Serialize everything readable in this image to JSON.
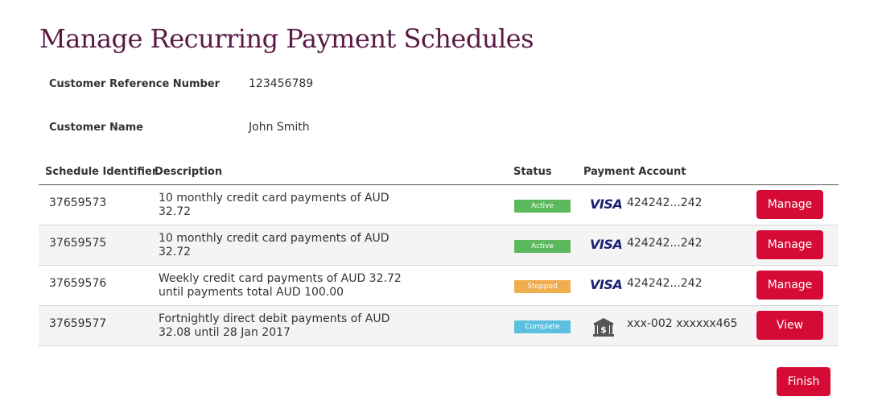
{
  "page": {
    "title": "Manage Recurring Payment Schedules"
  },
  "customer": {
    "reference_label": "Customer Reference Number",
    "reference_value": "123456789",
    "name_label": "Customer Name",
    "name_value": "John Smith"
  },
  "table": {
    "headers": {
      "schedule_id": "Schedule Identifier",
      "description": "Description",
      "status": "Status",
      "payment_account": "Payment Account"
    },
    "rows": [
      {
        "id": "37659573",
        "description": "10 monthly credit card payments of AUD 32.72",
        "status": "Active",
        "status_color": "#5cb85c",
        "account_type_icon": "visa-icon",
        "account_brand": "VISA",
        "account": "424242...242",
        "action": "Manage"
      },
      {
        "id": "37659575",
        "description": "10 monthly credit card payments of AUD 32.72",
        "status": "Active",
        "status_color": "#5cb85c",
        "account_type_icon": "visa-icon",
        "account_brand": "VISA",
        "account": "424242...242",
        "action": "Manage"
      },
      {
        "id": "37659576",
        "description": "Weekly credit card payments of AUD 32.72 until payments total AUD 100.00",
        "status": "Stopped",
        "status_color": "#f0ad4e",
        "account_type_icon": "visa-icon",
        "account_brand": "VISA",
        "account": "424242...242",
        "action": "Manage"
      },
      {
        "id": "37659577",
        "description": "Fortnightly direct debit payments of AUD 32.08 until 28 Jan 2017",
        "status": "Complete",
        "status_color": "#5bc0de",
        "account_type_icon": "bank-icon",
        "account": "xxx-002 xxxxxx465",
        "action": "View"
      }
    ]
  },
  "footer": {
    "finish_label": "Finish"
  },
  "colors": {
    "title": "#5a1a45",
    "button": "#d50b35",
    "visa_blue": "#1a1f71"
  }
}
